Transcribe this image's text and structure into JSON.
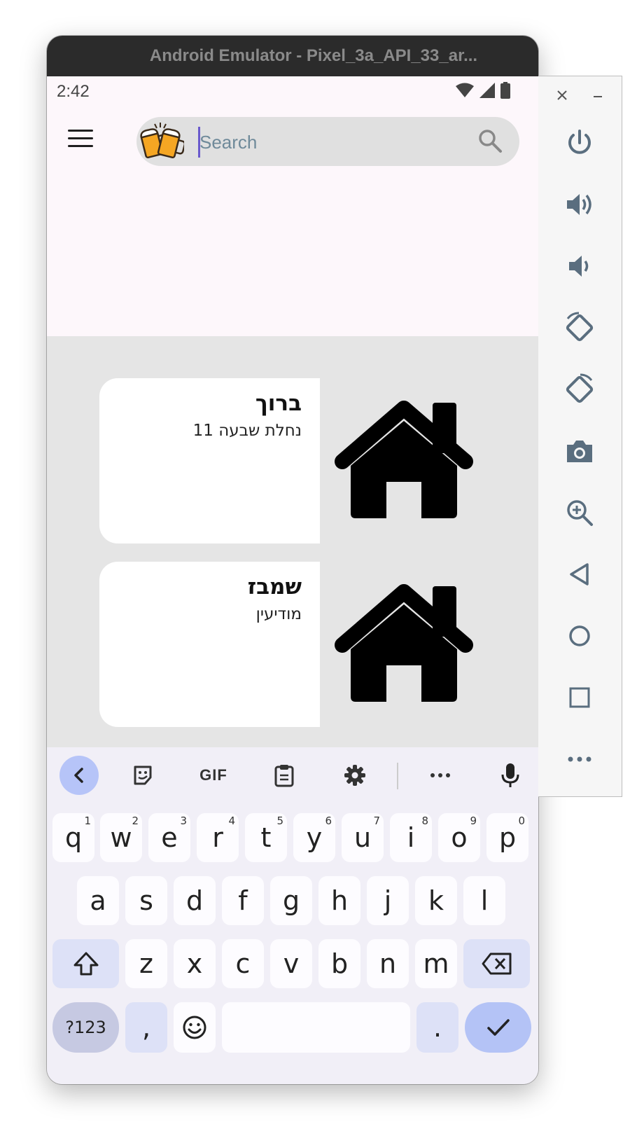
{
  "window": {
    "title": "Android Emulator - Pixel_3a_API_33_ar..."
  },
  "status_bar": {
    "time": "2:42"
  },
  "search": {
    "placeholder": "Search",
    "value": ""
  },
  "cards": [
    {
      "title": "ברוך",
      "subtitle": "נחלת שבעה 11"
    },
    {
      "title": "שמבז",
      "subtitle": "מודיעין"
    }
  ],
  "keyboard": {
    "toolbar": [
      "back",
      "sticker",
      "GIF",
      "clipboard",
      "settings",
      "more",
      "microphone"
    ],
    "gif_label": "GIF",
    "row1": [
      {
        "key": "q",
        "hint": "1"
      },
      {
        "key": "w",
        "hint": "2"
      },
      {
        "key": "e",
        "hint": "3"
      },
      {
        "key": "r",
        "hint": "4"
      },
      {
        "key": "t",
        "hint": "5"
      },
      {
        "key": "y",
        "hint": "6"
      },
      {
        "key": "u",
        "hint": "7"
      },
      {
        "key": "i",
        "hint": "8"
      },
      {
        "key": "o",
        "hint": "9"
      },
      {
        "key": "p",
        "hint": "0"
      }
    ],
    "row2": [
      "a",
      "s",
      "d",
      "f",
      "g",
      "h",
      "j",
      "k",
      "l"
    ],
    "row3": [
      "z",
      "x",
      "c",
      "v",
      "b",
      "n",
      "m"
    ],
    "symbols_label": "?123",
    "comma": ",",
    "period": "."
  },
  "side_panel": {
    "controls": [
      "close",
      "minimize",
      "power",
      "volume-up",
      "volume-down",
      "rotate-left",
      "rotate-right",
      "screenshot",
      "zoom",
      "back",
      "home",
      "overview",
      "more"
    ]
  },
  "colors": {
    "title_bar": "#2b2b2b",
    "app_background": "#fdf7fb",
    "content_background": "#e5e5e5",
    "search_background": "#e0e0e0",
    "keyboard_background": "#f1eff7",
    "accent": "#b4c3f6",
    "side_icons": "#5a6e7f"
  }
}
